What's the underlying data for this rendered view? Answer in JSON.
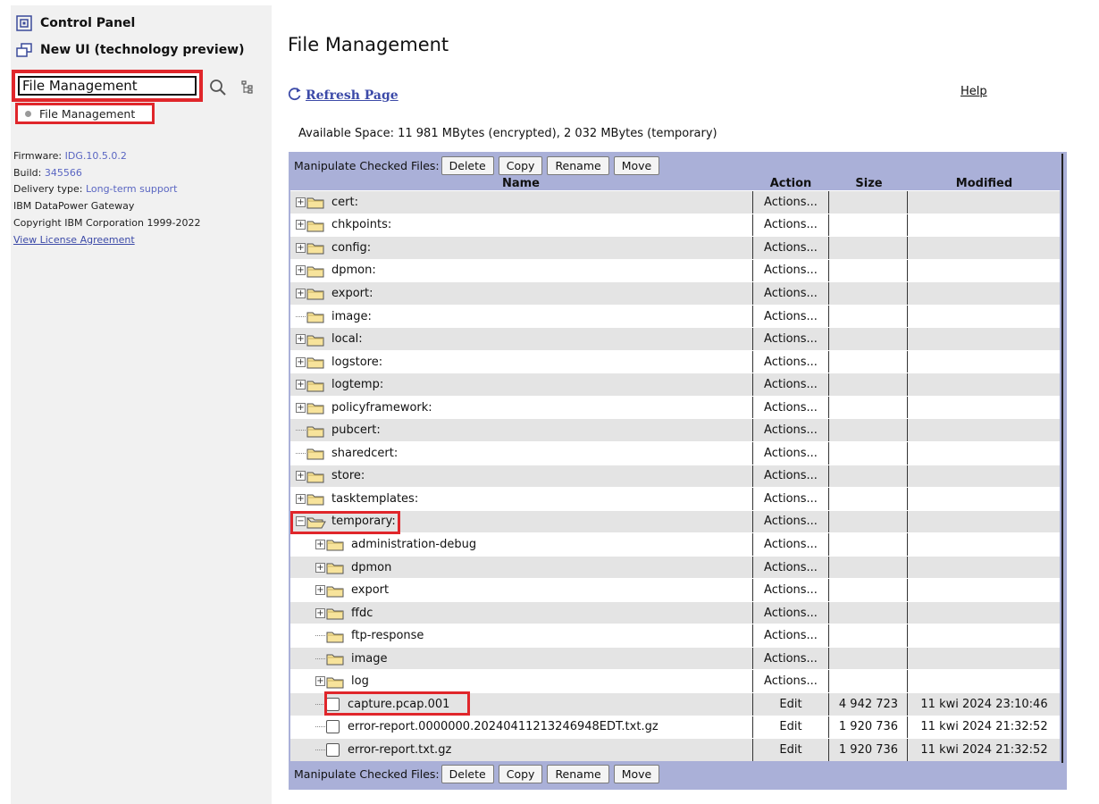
{
  "sidebar": {
    "control_panel": "Control Panel",
    "new_ui": "New UI (technology preview)",
    "search": {
      "value": "File Management",
      "placeholder": ""
    },
    "search_result": "File Management",
    "info": {
      "firmware_label": "Firmware:",
      "firmware_value": "IDG.10.5.0.2",
      "build_label": "Build:",
      "build_value": "345566",
      "delivery_label": "Delivery type:",
      "delivery_value": "Long-term support",
      "product": "IBM DataPower Gateway",
      "copyright": "Copyright IBM Corporation 1999-2022",
      "license_link": "View License Agreement"
    }
  },
  "main": {
    "title": "File Management",
    "refresh_label": "Refresh Page",
    "help_label": "Help",
    "available_space": "Available Space: 11 981 MBytes (encrypted), 2 032 MBytes (temporary)",
    "manipulate_label": "Manipulate Checked Files:",
    "buttons": [
      "Delete",
      "Copy",
      "Rename",
      "Move"
    ],
    "columns": {
      "name": "Name",
      "action": "Action",
      "size": "Size",
      "modified": "Modified"
    },
    "rows": [
      {
        "name": "cert:",
        "action": "Actions...",
        "size": "",
        "modified": ""
      },
      {
        "name": "chkpoints:",
        "action": "Actions...",
        "size": "",
        "modified": ""
      },
      {
        "name": "config:",
        "action": "Actions...",
        "size": "",
        "modified": ""
      },
      {
        "name": "dpmon:",
        "action": "Actions...",
        "size": "",
        "modified": ""
      },
      {
        "name": "export:",
        "action": "Actions...",
        "size": "",
        "modified": ""
      },
      {
        "name": "image:",
        "action": "Actions...",
        "size": "",
        "modified": ""
      },
      {
        "name": "local:",
        "action": "Actions...",
        "size": "",
        "modified": ""
      },
      {
        "name": "logstore:",
        "action": "Actions...",
        "size": "",
        "modified": ""
      },
      {
        "name": "logtemp:",
        "action": "Actions...",
        "size": "",
        "modified": ""
      },
      {
        "name": "policyframework:",
        "action": "Actions...",
        "size": "",
        "modified": ""
      },
      {
        "name": "pubcert:",
        "action": "Actions...",
        "size": "",
        "modified": ""
      },
      {
        "name": "sharedcert:",
        "action": "Actions...",
        "size": "",
        "modified": ""
      },
      {
        "name": "store:",
        "action": "Actions...",
        "size": "",
        "modified": ""
      },
      {
        "name": "tasktemplates:",
        "action": "Actions...",
        "size": "",
        "modified": ""
      },
      {
        "name": "temporary:",
        "action": "Actions...",
        "size": "",
        "modified": ""
      },
      {
        "name": "administration-debug",
        "action": "Actions...",
        "size": "",
        "modified": ""
      },
      {
        "name": "dpmon",
        "action": "Actions...",
        "size": "",
        "modified": ""
      },
      {
        "name": "export",
        "action": "Actions...",
        "size": "",
        "modified": ""
      },
      {
        "name": "ffdc",
        "action": "Actions...",
        "size": "",
        "modified": ""
      },
      {
        "name": "ftp-response",
        "action": "Actions...",
        "size": "",
        "modified": ""
      },
      {
        "name": "image",
        "action": "Actions...",
        "size": "",
        "modified": ""
      },
      {
        "name": "log",
        "action": "Actions...",
        "size": "",
        "modified": ""
      },
      {
        "name": "capture.pcap.001",
        "action": "Edit",
        "size": "4 942 723",
        "modified": "11 kwi 2024 23:10:46"
      },
      {
        "name": "error-report.0000000.20240411213246948EDT.txt.gz",
        "action": "Edit",
        "size": "1 920 736",
        "modified": "11 kwi 2024 21:32:52"
      },
      {
        "name": "error-report.txt.gz",
        "action": "Edit",
        "size": "1 920 736",
        "modified": "11 kwi 2024 21:32:52"
      }
    ]
  }
}
